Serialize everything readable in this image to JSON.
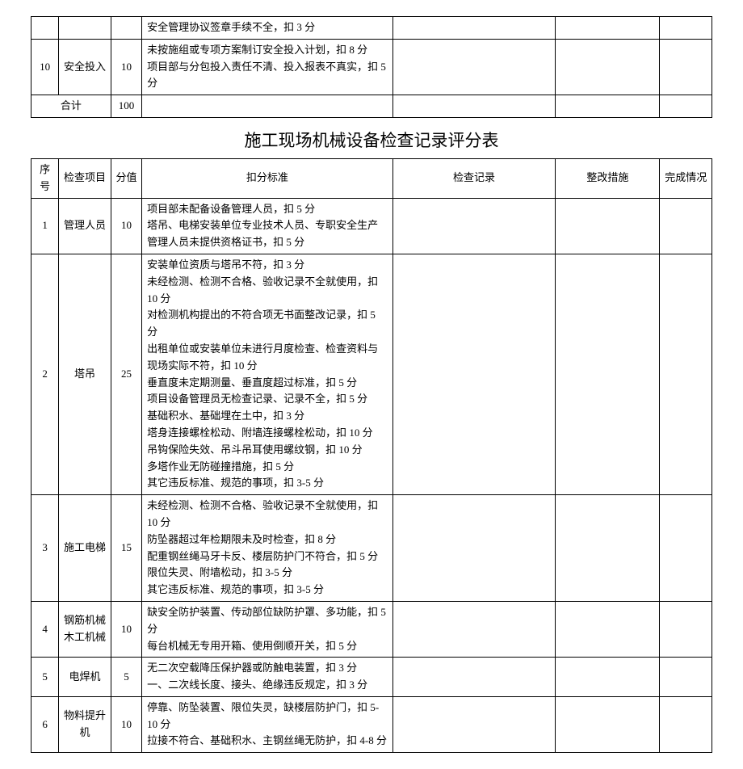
{
  "upper": {
    "row_frag": "安全管理协议签章手续不全，扣 3 分",
    "row10": {
      "seq": "10",
      "item": "安全投入",
      "score": "10",
      "criteria": "未按施组或专项方案制订安全投入计划，扣 8 分\n项目部与分包投入责任不清、投入报表不真实，扣 5 分"
    },
    "total_label": "合计",
    "total_score": "100"
  },
  "title": "施工现场机械设备检查记录评分表",
  "headers": {
    "seq": "序号",
    "item": "检查项目",
    "score": "分值",
    "criteria": "扣分标准",
    "record": "检查记录",
    "remedy": "整改措施",
    "done": "完成情况"
  },
  "rows": [
    {
      "seq": "1",
      "item": "管理人员",
      "score": "10",
      "criteria": "项目部未配备设备管理人员，扣 5 分\n塔吊、电梯安装单位专业技术人员、专职安全生产管理人员未提供资格证书，扣 5 分"
    },
    {
      "seq": "2",
      "item": "塔吊",
      "score": "25",
      "criteria": "安装单位资质与塔吊不符，扣 3 分\n未经检测、检测不合格、验收记录不全就使用，扣 10 分\n对检测机构提出的不符合项无书面整改记录，扣 5 分\n出租单位或安装单位未进行月度检查、检查资料与现场实际不符，扣 10 分\n垂直度未定期测量、垂直度超过标准，扣 5 分\n项目设备管理员无检查记录、记录不全，扣 5 分\n基础积水、基础埋在土中，扣 3 分\n塔身连接螺栓松动、附墙连接螺栓松动，扣 10 分\n吊钩保险失效、吊斗吊耳使用螺纹钢，扣 10 分\n多塔作业无防碰撞措施，扣 5 分\n其它违反标准、规范的事项，扣 3-5 分"
    },
    {
      "seq": "3",
      "item": "施工电梯",
      "score": "15",
      "criteria": "未经检测、检测不合格、验收记录不全就使用，扣 10 分\n防坠器超过年检期限未及时检查，扣 8 分\n配重钢丝绳马牙卡反、楼层防护门不符合，扣 5 分\n限位失灵、附墙松动，扣 3-5 分\n其它违反标准、规范的事项，扣 3-5 分"
    },
    {
      "seq": "4",
      "item": "钢筋机械木工机械",
      "score": "10",
      "criteria": "缺安全防护装置、传动部位缺防护罩、多功能，扣 5 分\n每台机械无专用开箱、使用倒顺开关，扣 5 分"
    },
    {
      "seq": "5",
      "item": "电焊机",
      "score": "5",
      "criteria": "无二次空载降压保护器或防触电装置，扣 3 分\n一、二次线长度、接头、绝缘违反规定，扣 3 分"
    },
    {
      "seq": "6",
      "item": "物料提升机",
      "score": "10",
      "criteria": "停靠、防坠装置、限位失灵，缺楼层防护门，扣 5-10 分\n拉接不符合、基础积水、主钢丝绳无防护，扣 4-8 分"
    }
  ]
}
